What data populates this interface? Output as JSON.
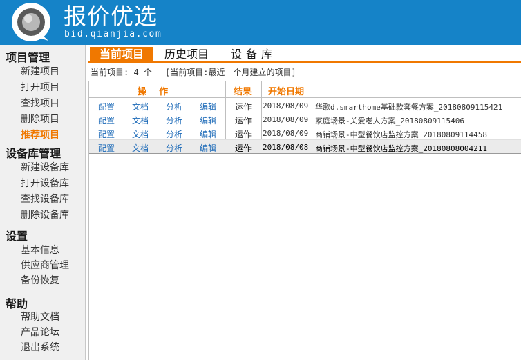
{
  "brand": {
    "title": "报价优选",
    "subtitle": "bid.qianjia.com",
    "color": "#1583c8"
  },
  "accent_color": "#f07800",
  "sidebar": {
    "sections": [
      {
        "title": "项目管理",
        "items": [
          "新建项目",
          "打开项目",
          "查找项目",
          "删除项目",
          "推荐项目"
        ]
      },
      {
        "title": "设备库管理",
        "items": [
          "新建设备库",
          "打开设备库",
          "查找设备库",
          "删除设备库"
        ]
      },
      {
        "title": "设置",
        "items": [
          "基本信息",
          "供应商管理",
          "备份恢复"
        ]
      },
      {
        "title": "帮助",
        "items": [
          "帮助文档",
          "产品论坛",
          "退出系统"
        ]
      }
    ],
    "active_item": "推荐项目"
  },
  "tabs": [
    {
      "label": "当前项目",
      "active": true
    },
    {
      "label": "历史项目",
      "active": false
    },
    {
      "label": "设备库",
      "active": false
    }
  ],
  "summary": {
    "count_text": "当前项目: 4 个",
    "filter_text": "[当前项目:最近一个月建立的项目]"
  },
  "table": {
    "headers": {
      "ops": "操    作",
      "result": "结果",
      "start_date": "开始日期"
    },
    "rows": [
      {
        "ops": [
          "配置",
          "文档",
          "分析",
          "编辑"
        ],
        "result": "运作",
        "date": "2018/08/09",
        "name": "华歌d.smarthome基础款套餐方案_20180809115421"
      },
      {
        "ops": [
          "配置",
          "文档",
          "分析",
          "编辑"
        ],
        "result": "运作",
        "date": "2018/08/09",
        "name": "家庭场景-关爱老人方案_20180809115406"
      },
      {
        "ops": [
          "配置",
          "文档",
          "分析",
          "编辑"
        ],
        "result": "运作",
        "date": "2018/08/09",
        "name": "商铺场景-中型餐饮店监控方案_20180809114458"
      },
      {
        "ops": [
          "配置",
          "文档",
          "分析",
          "编辑"
        ],
        "result": "运作",
        "date": "2018/08/08",
        "name": "商铺场景-中型餐饮店监控方案_20180808004211",
        "selected": true
      }
    ]
  }
}
